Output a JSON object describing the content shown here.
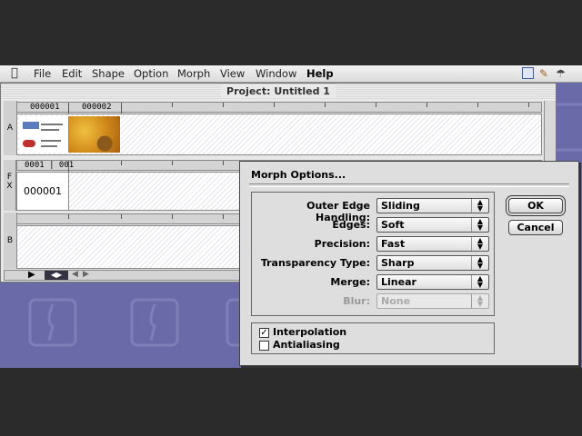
{
  "menubar": {
    "items": [
      "File",
      "Edit",
      "Shape",
      "Option",
      "Morph",
      "View",
      "Window",
      "Help"
    ]
  },
  "window": {
    "title": "Project: Untitled 1",
    "timeline": {
      "frame_start": "000001",
      "frame_end": "000002",
      "track_a_label": "A",
      "fx_ruler_text": "0001 | 001",
      "fx_label": "F X",
      "fx_frame": "000001",
      "track_b_label": "B"
    }
  },
  "dialog": {
    "title": "Morph Options...",
    "fields": [
      {
        "label": "Outer Edge Handling:",
        "value": "Sliding",
        "enabled": true
      },
      {
        "label": "Edges:",
        "value": "Soft",
        "enabled": true
      },
      {
        "label": "Precision:",
        "value": "Fast",
        "enabled": true
      },
      {
        "label": "Transparency Type:",
        "value": "Sharp",
        "enabled": true
      },
      {
        "label": "Merge:",
        "value": "Linear",
        "enabled": true
      },
      {
        "label": "Blur:",
        "value": "None",
        "enabled": false
      }
    ],
    "ok_label": "OK",
    "cancel_label": "Cancel",
    "checkboxes": [
      {
        "label": "Interpolation",
        "checked": true
      },
      {
        "label": "Antialiasing",
        "checked": false
      }
    ]
  }
}
